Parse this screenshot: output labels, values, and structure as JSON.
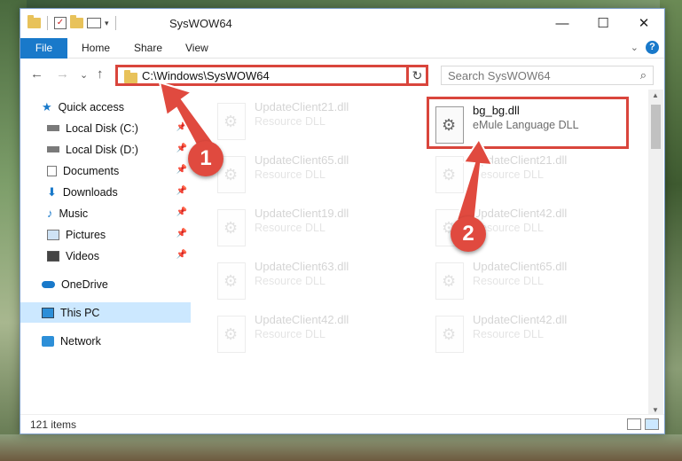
{
  "window": {
    "title": "SysWOW64",
    "controls": {
      "minimize": "—",
      "maximize": "☐",
      "close": "✕"
    }
  },
  "ribbon": {
    "tabs": [
      "File",
      "Home",
      "Share",
      "View"
    ],
    "help": "?",
    "collapse": "⌄"
  },
  "address": {
    "path": "C:\\Windows\\SysWOW64",
    "search_placeholder": "Search SysWOW64",
    "back": "←",
    "forward": "→",
    "recent": "⌄",
    "up": "↑",
    "refresh": "↻",
    "dropdown": "⌄",
    "search_icon": "⌕"
  },
  "nav": {
    "items": [
      {
        "label": "Quick access",
        "icon": "star-icon"
      },
      {
        "label": "Local Disk (C:)",
        "icon": "drive-icon",
        "pinned": true
      },
      {
        "label": "Local Disk (D:)",
        "icon": "drive-icon",
        "pinned": true
      },
      {
        "label": "Documents",
        "icon": "documents-icon",
        "pinned": true
      },
      {
        "label": "Downloads",
        "icon": "download-icon",
        "pinned": true
      },
      {
        "label": "Music",
        "icon": "music-icon",
        "pinned": true
      },
      {
        "label": "Pictures",
        "icon": "pictures-icon",
        "pinned": true
      },
      {
        "label": "Videos",
        "icon": "videos-icon",
        "pinned": true
      },
      {
        "label": "OneDrive",
        "icon": "cloud-icon"
      },
      {
        "label": "This PC",
        "icon": "computer-icon",
        "selected": true
      },
      {
        "label": "Network",
        "icon": "network-icon"
      }
    ]
  },
  "files": {
    "left_column": [
      {
        "name": "UpdateClient21.dll",
        "type": "Resource DLL"
      },
      {
        "name": "UpdateClient65.dll",
        "type": "Resource DLL"
      },
      {
        "name": "UpdateClient19.dll",
        "type": "Resource DLL"
      },
      {
        "name": "UpdateClient63.dll",
        "type": "Resource DLL"
      },
      {
        "name": "UpdateClient42.dll",
        "type": "Resource DLL"
      }
    ],
    "right_column": [
      {
        "name": "bg_bg.dll",
        "type": "eMule Language DLL",
        "highlighted": true
      },
      {
        "name": "UpdateClient21.dll",
        "type": "Resource DLL"
      },
      {
        "name": "UpdateClient42.dll",
        "type": "Resource DLL"
      },
      {
        "name": "UpdateClient65.dll",
        "type": "Resource DLL"
      },
      {
        "name": "UpdateClient42.dll",
        "type": "Resource DLL"
      }
    ]
  },
  "status": {
    "item_count": "121 items"
  },
  "annotations": {
    "step1": "1",
    "step2": "2"
  },
  "colors": {
    "accent": "#1979ca",
    "highlight": "#d9453c",
    "selected": "#cce8ff"
  }
}
